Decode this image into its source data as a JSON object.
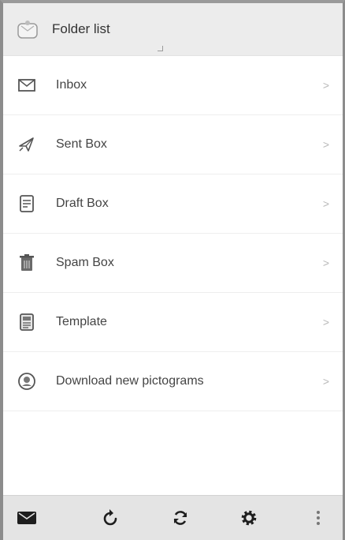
{
  "header": {
    "title": "Folder list",
    "icon": "envelope-badge-icon"
  },
  "folders": [
    {
      "label": "Inbox",
      "icon": "inbox-icon"
    },
    {
      "label": "Sent Box",
      "icon": "sent-icon"
    },
    {
      "label": "Draft Box",
      "icon": "draft-icon"
    },
    {
      "label": "Spam Box",
      "icon": "trash-icon"
    },
    {
      "label": "Template",
      "icon": "template-icon"
    },
    {
      "label": "Download new pictograms",
      "icon": "download-icon"
    }
  ],
  "chevron": ">",
  "toolbar": {
    "items": [
      "compose-icon",
      "refresh-icon",
      "sync-icon",
      "settings-icon",
      "more-icon"
    ]
  },
  "colors": {
    "header_bg": "#ececec",
    "toolbar_bg": "#e4e4e4",
    "text": "#444444",
    "icon": "#555555",
    "border": "#8c8c8c"
  }
}
